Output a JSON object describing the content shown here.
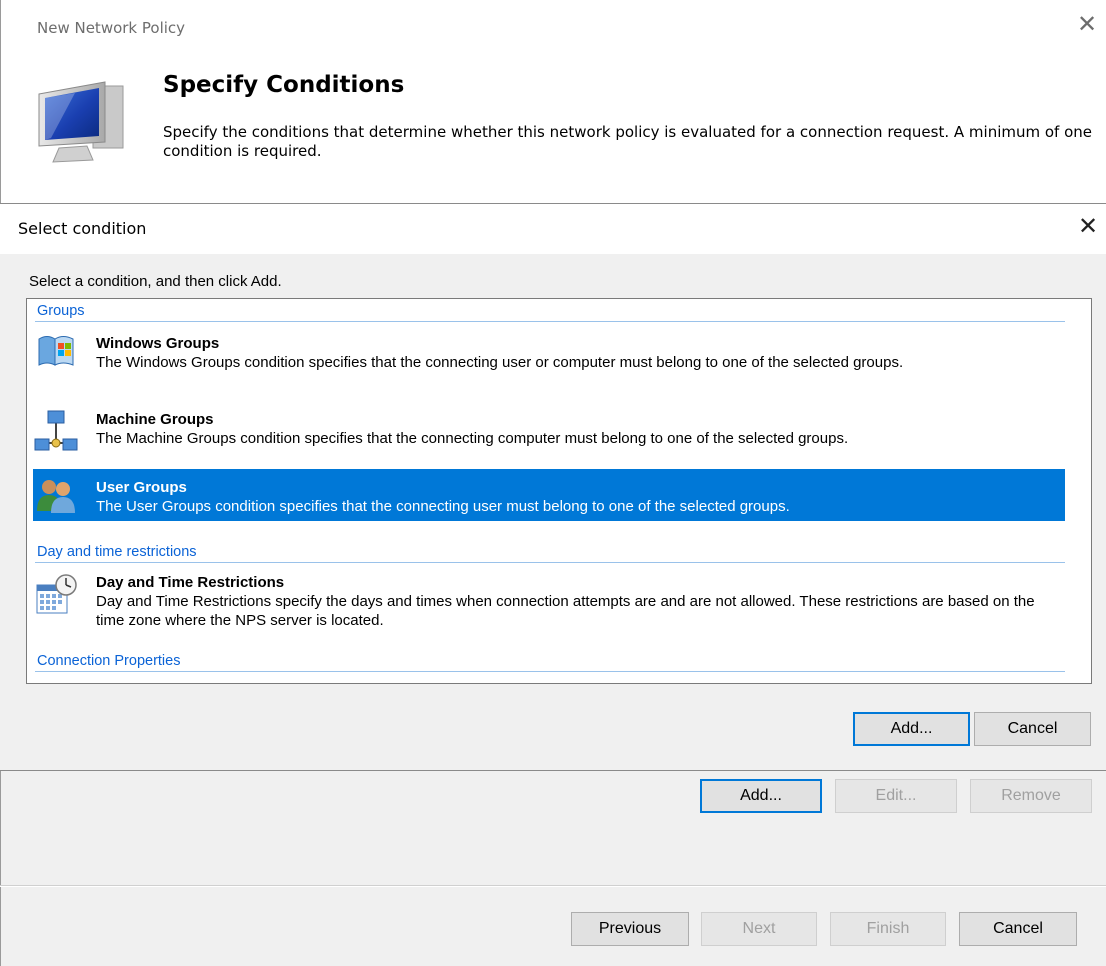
{
  "wizard": {
    "title": "New Network Policy",
    "heading": "Specify Conditions",
    "description": "Specify the conditions that determine whether this network policy is evaluated for a connection request. A minimum of one condition is required.",
    "close_glyph": "✕"
  },
  "dialog": {
    "title": "Select condition",
    "close_glyph": "✕",
    "instruction": "Select a condition, and then click Add.",
    "categories": [
      "Groups",
      "Day and time restrictions",
      "Connection Properties"
    ],
    "items": [
      {
        "title": "Windows Groups",
        "description": "The Windows Groups condition specifies that the connecting user or computer must belong to one of the selected groups.",
        "icon": "windows-groups-icon",
        "selected": false
      },
      {
        "title": "Machine Groups",
        "description": "The Machine Groups condition specifies that the connecting computer must belong to one of the selected groups.",
        "icon": "machine-groups-icon",
        "selected": false
      },
      {
        "title": "User Groups",
        "description": "The User Groups condition specifies that the connecting user must belong to one of the selected groups.",
        "icon": "user-groups-icon",
        "selected": true
      },
      {
        "title": "Day and Time Restrictions",
        "description": "Day and Time Restrictions specify the days and times when connection attempts are and are not allowed. These restrictions are based on the time zone where the NPS server is located.",
        "icon": "calendar-clock-icon",
        "selected": false
      }
    ],
    "scroll_up": "⌃",
    "scroll_down": "⌄",
    "add_label": "Add...",
    "cancel_label": "Cancel"
  },
  "conditions_buttons": {
    "add_label": "Add...",
    "edit_label": "Edit...",
    "remove_label": "Remove"
  },
  "footer": {
    "previous_label": "Previous",
    "next_label": "Next",
    "finish_label": "Finish",
    "cancel_label": "Cancel"
  },
  "colors": {
    "selection": "#0078d7",
    "category_text": "#0b63d6"
  }
}
